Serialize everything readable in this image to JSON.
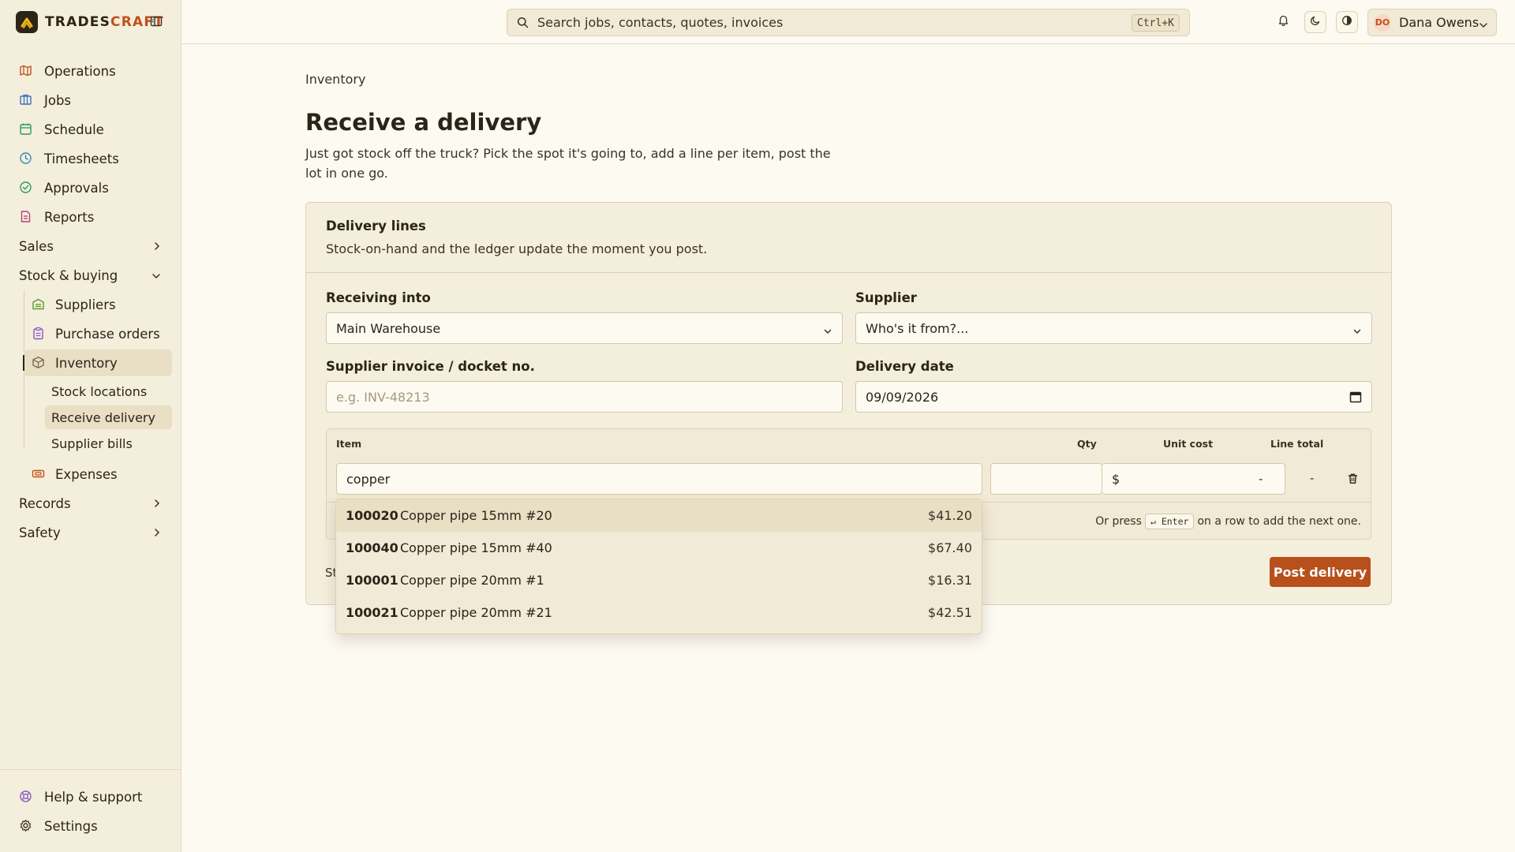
{
  "brand": {
    "name_a": "TRADES",
    "name_b": "CRAFT"
  },
  "sidebar": {
    "items": [
      {
        "label": "Operations",
        "icon": "map-icon",
        "color": "#c0501a"
      },
      {
        "label": "Jobs",
        "icon": "building-icon",
        "color": "#3a72c0"
      },
      {
        "label": "Schedule",
        "icon": "calendar-icon",
        "color": "#2f9a5a"
      },
      {
        "label": "Timesheets",
        "icon": "clock-icon",
        "color": "#2a8fb0"
      },
      {
        "label": "Approvals",
        "icon": "check-circle-icon",
        "color": "#2f9a5a"
      },
      {
        "label": "Reports",
        "icon": "report-icon",
        "color": "#b8407a"
      }
    ],
    "groups": {
      "sales": "Sales",
      "stock": "Stock & buying",
      "records": "Records",
      "safety": "Safety"
    },
    "stock_items": {
      "suppliers": "Suppliers",
      "purchase_orders": "Purchase orders",
      "inventory": "Inventory",
      "stock_locations": "Stock locations",
      "receive_delivery": "Receive delivery",
      "supplier_bills": "Supplier bills",
      "expenses": "Expenses"
    },
    "bottom": {
      "help": "Help & support",
      "settings": "Settings"
    }
  },
  "topbar": {
    "search_placeholder": "Search jobs, contacts, quotes, invoices",
    "search_shortcut": "Ctrl+K",
    "user_initials": "DO",
    "user_name": "Dana Owens"
  },
  "page": {
    "breadcrumb": "Inventory",
    "title": "Receive a delivery",
    "subtitle": "Just got stock off the truck? Pick the spot it's going to, add a line per item, post the lot in one go."
  },
  "card": {
    "title": "Delivery lines",
    "desc": "Stock-on-hand and the ledger update the moment you post.",
    "receiving_label": "Receiving into",
    "receiving_value": "Main Warehouse",
    "supplier_label": "Supplier",
    "supplier_value": "Who's it from?...",
    "invoice_label": "Supplier invoice / docket no.",
    "invoice_placeholder": "e.g. INV-48213",
    "date_label": "Delivery date",
    "date_value": "09/09/2026",
    "table": {
      "col_item": "Item",
      "col_qty": "Qty",
      "col_unit_cost": "Unit cost",
      "col_line_total": "Line total",
      "item_value": "copper",
      "currency": "$",
      "unit_dash": "-",
      "total_dash": "-",
      "hint_pre": "Or press",
      "hint_key": "↵ Enter",
      "hint_post": "on a row to add the next one."
    },
    "st_text": "St",
    "post_button": "Post delivery"
  },
  "dropdown": [
    {
      "code": "100020",
      "name": "Copper pipe 15mm #20",
      "price": "$41.20"
    },
    {
      "code": "100040",
      "name": "Copper pipe 15mm #40",
      "price": "$67.40"
    },
    {
      "code": "100001",
      "name": "Copper pipe 20mm #1",
      "price": "$16.31"
    },
    {
      "code": "100021",
      "name": "Copper pipe 20mm #21",
      "price": "$42.51"
    }
  ],
  "colors": {
    "accent": "#b8501c",
    "background": "#fdfaf2",
    "sidebar": "#f4eedd"
  }
}
